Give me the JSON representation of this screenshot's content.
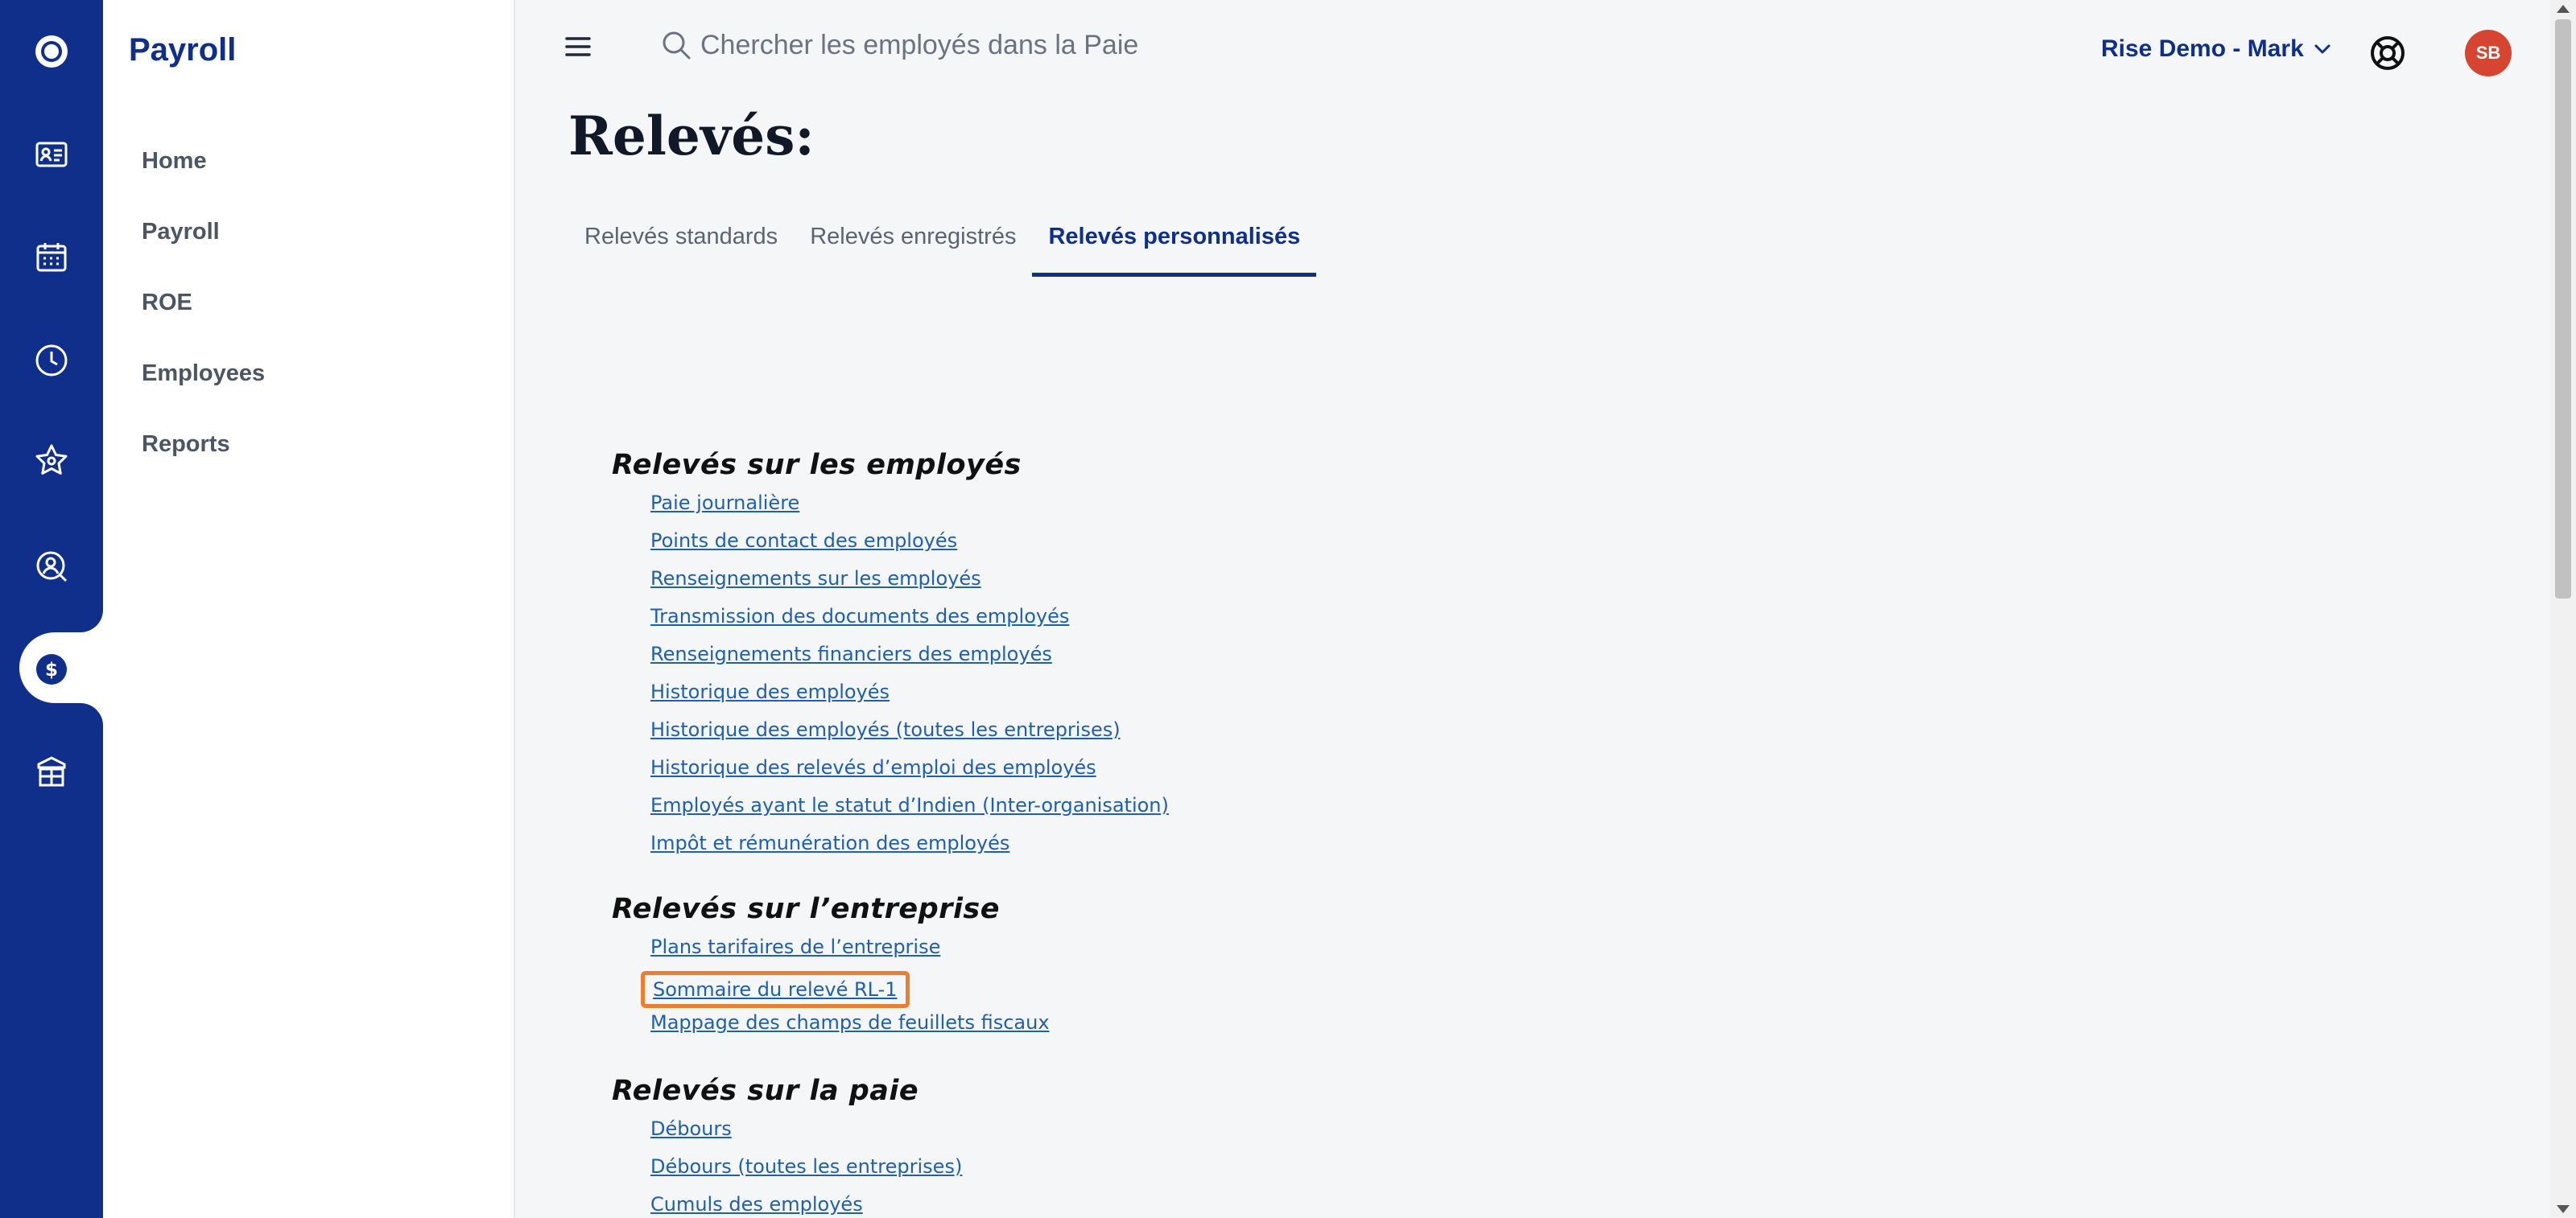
{
  "sidebar": {
    "title": "Payroll",
    "items": [
      {
        "label": "Home"
      },
      {
        "label": "Payroll"
      },
      {
        "label": "ROE"
      },
      {
        "label": "Employees"
      },
      {
        "label": "Reports"
      }
    ]
  },
  "rail": {
    "icons": [
      "logo-icon",
      "id-card-icon",
      "calendar-icon",
      "clock-icon",
      "star-icon",
      "user-search-icon",
      "dollar-icon",
      "gift-box-icon"
    ],
    "active_icon": "dollar-icon"
  },
  "header": {
    "search_placeholder": "Chercher les employés dans la Paie",
    "account_label": "Rise Demo - Mark",
    "avatar_initials": "SB"
  },
  "page": {
    "title": "Relevés:",
    "tabs": [
      {
        "label": "Relevés standards",
        "active": false
      },
      {
        "label": "Relevés enregistrés",
        "active": false
      },
      {
        "label": "Relevés personnalisés",
        "active": true
      }
    ]
  },
  "sections": [
    {
      "heading": "Relevés sur les employés",
      "links": [
        "Paie journalière",
        "Points de contact des employés",
        "Renseignements sur les employés",
        "Transmission des documents des employés",
        "Renseignements financiers des employés",
        "Historique des employés",
        "Historique des employés (toutes les entreprises)",
        "Historique des relevés d’emploi des employés",
        "Employés ayant le statut d’Indien (Inter-organisation)",
        "Impôt et rémunération des employés"
      ]
    },
    {
      "heading": "Relevés sur l’entreprise",
      "links": [
        "Plans tarifaires de l’entreprise",
        "Sommaire du relevé RL-1",
        "Mappage des champs de feuillets fiscaux"
      ]
    },
    {
      "heading": "Relevés sur la paie",
      "links": [
        "Débours",
        "Débours (toutes les entreprises)",
        "Cumuls des employés"
      ]
    }
  ],
  "colors": {
    "brand": "#0f2f8a",
    "link": "#1f5fae",
    "highlight": "#f07c30",
    "avatar": "#d64532"
  }
}
